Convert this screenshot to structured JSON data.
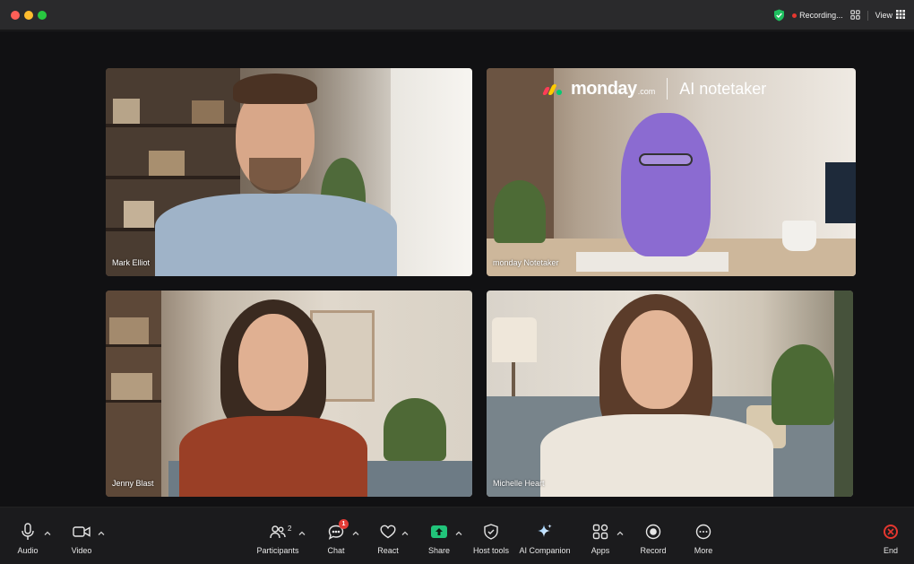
{
  "window": {
    "status": {
      "recording_label": "Recording...",
      "view_label": "View"
    }
  },
  "tiles": [
    {
      "name": "Mark Elliot"
    },
    {
      "name": "monday Notetaker"
    },
    {
      "name": "Jenny Blast"
    },
    {
      "name": "Michelle Heart"
    }
  ],
  "branding": {
    "word": "monday",
    "suffix": ".com",
    "product": "AI notetaker",
    "colors": [
      "#ff3d57",
      "#ffcb00",
      "#00ca72"
    ]
  },
  "toolbar": {
    "audio": "Audio",
    "video": "Video",
    "participants": "Participants",
    "participants_count": "2",
    "chat": "Chat",
    "chat_badge": "1",
    "react": "React",
    "share": "Share",
    "host_tools": "Host tools",
    "ai_companion": "AI Companion",
    "apps": "Apps",
    "record": "Record",
    "more": "More",
    "end": "End"
  },
  "colors": {
    "share_accent": "#21c47a",
    "end_accent": "#e5372f",
    "secure_shield": "#1fbf5f"
  }
}
